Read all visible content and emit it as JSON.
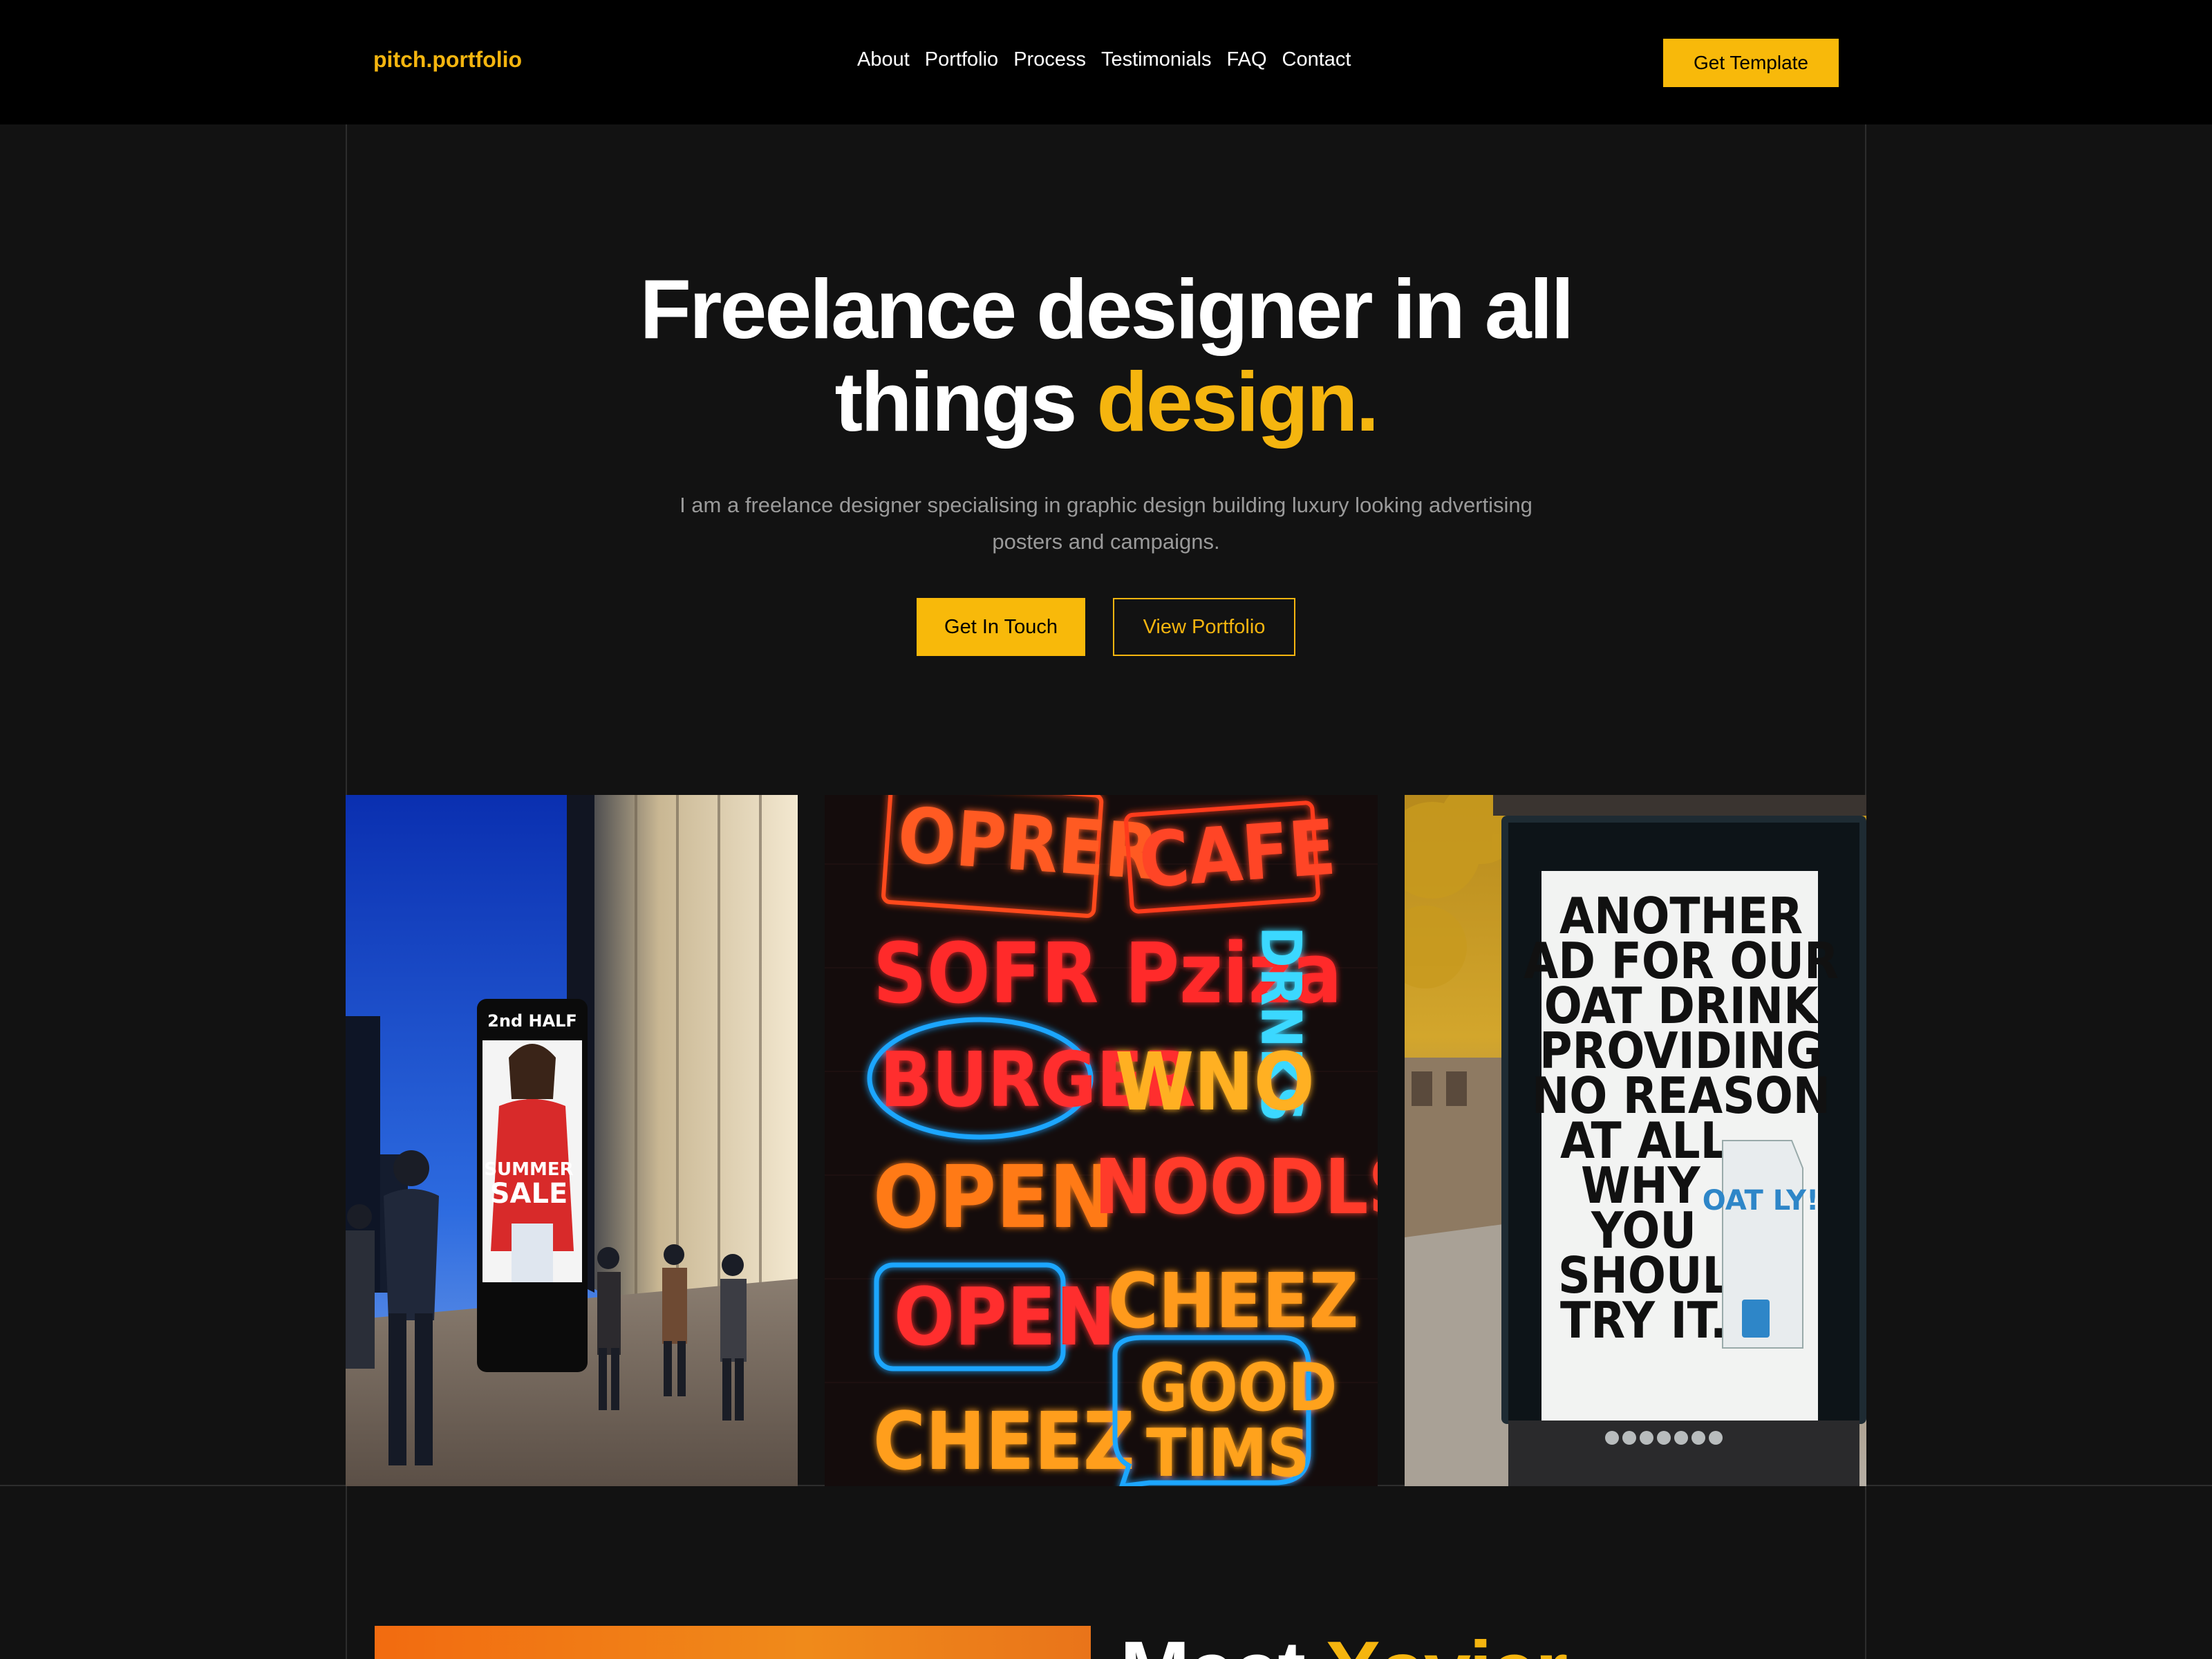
{
  "nav": {
    "logo": "pitch.portfolio",
    "links": [
      "About",
      "Portfolio",
      "Process",
      "Testimonials",
      "FAQ",
      "Contact"
    ],
    "cta": "Get Template"
  },
  "hero": {
    "title_line1": "Freelance designer in all",
    "title_line2_plain": "things",
    "title_line2_accent": "design.",
    "subtitle_line1": "I am a freelance designer specialising in graphic design building luxury looking advertising",
    "subtitle_line2": "posters and campaigns.",
    "primary_button": "Get In Touch",
    "secondary_button": "View Portfolio"
  },
  "gallery": {
    "poster1_top": "2nd HALF",
    "poster1_sale1": "SUMMER",
    "poster1_sale2": "SALE",
    "neon": {
      "w1": "OPRER",
      "w2": "CAFE",
      "w3": "SOFR Pziza",
      "w4": "DRNKS",
      "w5": "BURGER",
      "w6": "WNO",
      "w7": "OPEN",
      "w8": "NOODLS",
      "w9": "CHEEZ",
      "w10": "OPEN",
      "w11": "CHEEZ",
      "w12": "GOOD",
      "w13": "TIMS"
    },
    "poster3_lines": [
      "ANOTHER",
      "AD FOR OUR",
      "OAT DRINK",
      "PROVIDING",
      "NO REASON",
      "AT ALL",
      "WHY",
      "YOU",
      "SHOULD",
      "TRY IT."
    ],
    "carton": "OAT LY!"
  },
  "about": {
    "title_plain": "Meet",
    "title_accent": "Xavier"
  },
  "colors": {
    "accent": "#f5b50f",
    "bg": "#121212",
    "nav_bg": "#000000"
  }
}
